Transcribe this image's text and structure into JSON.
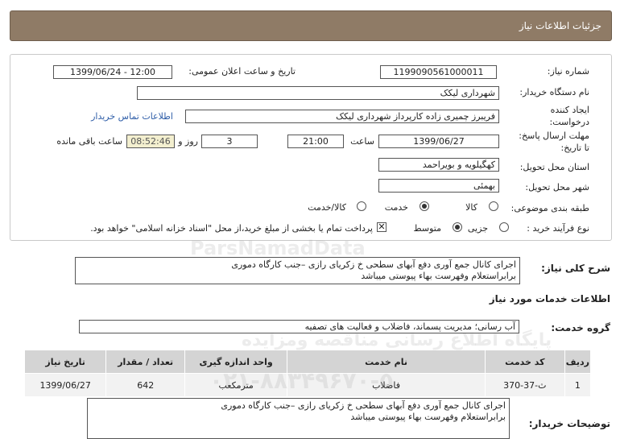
{
  "header": {
    "title": "جزئیات اطلاعات نیاز"
  },
  "form": {
    "need_number_label": "شماره نیاز:",
    "need_number": "1199090561000011",
    "announce_label": "تاریخ و ساعت اعلان عمومی:",
    "announce_value": "1399/06/24 - 12:00",
    "buyer_org_label": "نام دستگاه خریدار:",
    "buyer_org": "شهرداری لیکک",
    "creator_label_1": "ایجاد کننده",
    "creator_label_2": "درخواست:",
    "creator": "فریبرز  چمیری زاده کارپرداز شهرداری لیکک",
    "contact_link": "اطلاعات تماس خریدار",
    "deadline_label_1": "مهلت ارسال پاسخ:",
    "deadline_label_2": "تا تاریخ:",
    "deadline_date": "1399/06/27",
    "time_label": "ساعت",
    "deadline_time": "21:00",
    "days_value": "3",
    "days_label": "روز و",
    "remaining_time": "08:52:46",
    "remaining_label": "ساعت باقی مانده",
    "province_label": "استان محل تحویل:",
    "province": "کهگیلویه و بویراحمد",
    "city_label": "شهر محل تحویل:",
    "city": "بهمئی",
    "category_label": "طبقه بندی موضوعی:",
    "category_options": [
      "کالا",
      "خدمت",
      "کالا/خدمت"
    ],
    "category_selected": "خدمت",
    "process_label": "نوع فرآیند خرید :",
    "process_options": [
      "جزیی",
      "متوسط"
    ],
    "process_selected": "متوسط",
    "payment_note": "پرداخت تمام یا بخشی از مبلغ خرید،از محل \"اسناد خزانه اسلامی\" خواهد بود."
  },
  "summary": {
    "label": "شرح کلی نیاز:",
    "line1": "اجرای کانال جمع آوری دفع آبهای سطحی خ زکریای رازی –جنب کارگاه دموری",
    "line2": "برابراستعلام وفهرست بهاء پیوستی میباشد"
  },
  "services": {
    "section_title": "اطلاعات خدمات مورد نیاز",
    "group_label": "گروه خدمت:",
    "group_value": "آب رسانی؛ مدیریت پسماند، فاضلاب و فعالیت های تصفیه",
    "columns": [
      "ردیف",
      "کد خدمت",
      "نام خدمت",
      "واحد اندازه گیری",
      "تعداد / مقدار",
      "تاریخ نیاز"
    ],
    "rows": [
      {
        "row": "1",
        "code": "ث-37-370",
        "name": "فاضلاب",
        "unit": "مترمکعب",
        "qty": "642",
        "date": "1399/06/27"
      }
    ]
  },
  "buyer_notes": {
    "label": "توضیحات خریدار:",
    "line1": "اجرای کانال جمع آوری دفع آبهای سطحی خ زکریای رازی –جنب کارگاه دموری",
    "line2": "برابراستعلام وفهرست بهاء پیوستی میباشد"
  },
  "watermark": {
    "line1": "ParsNamadData",
    "line2": "پایگاه اطلاع رسانی مناقصه ومزایده",
    "line3": "۰۲۱-۸۸۳۴۹۶۷۰-۵"
  }
}
